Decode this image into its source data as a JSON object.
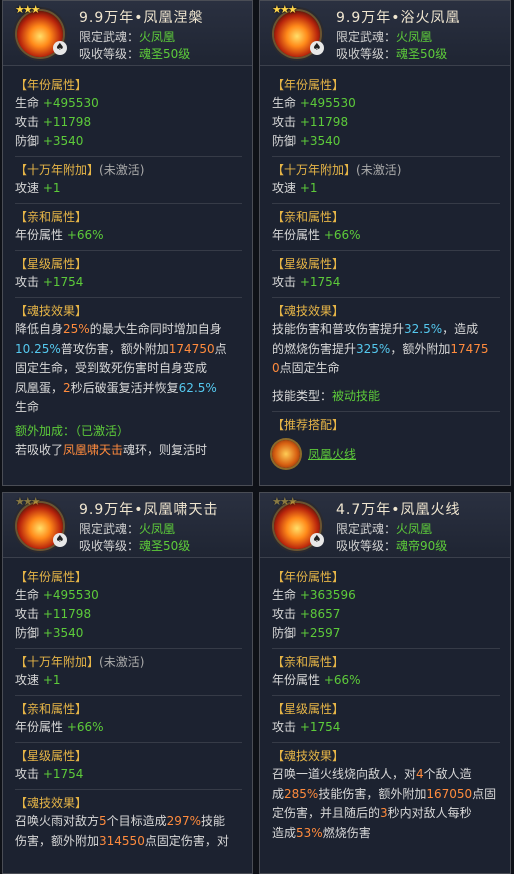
{
  "cards": [
    {
      "title": "9.9万年•凤凰涅槃",
      "limit_label": "限定武魂：",
      "limit_value": "火凤凰",
      "level_label": "吸收等级：",
      "level_value": "魂圣50级",
      "year": {
        "header": "【年份属性】",
        "hp_label": "生命",
        "hp": "+495530",
        "atk_label": "攻击",
        "atk": "+11798",
        "def_label": "防御",
        "def": "+3540"
      },
      "bonus": {
        "header": "【十万年附加】",
        "status": "(未激活)",
        "label": "攻速",
        "value": "+1"
      },
      "affinity": {
        "header": "【亲和属性】",
        "label": "年份属性",
        "value": "+66%"
      },
      "star": {
        "header": "【星级属性】",
        "label": "攻击",
        "value": "+1754"
      },
      "skill_header": "【魂技效果】",
      "skill": {
        "l1a": "降低自身",
        "l1b": "25%",
        "l1c": "的最大生命同时增加自身",
        "l2a": "10.25%",
        "l2b": "普攻伤害，额外附加",
        "l2c": "174750",
        "l2d": "点",
        "l3": "固定生命，受到致死伤害时自身变成",
        "l4a": "凤凰蛋，",
        "l4b": "2",
        "l4c": "秒后破蛋复活并恢复",
        "l4d": "62.5%",
        "l5": "生命"
      },
      "extra": {
        "label": "额外加成：（已激活）",
        "l1a": "若吸收了",
        "l1b": "凤凰啸天击",
        "l1c": "魂环，则复活时"
      }
    },
    {
      "title": "9.9万年•浴火凤凰",
      "limit_label": "限定武魂：",
      "limit_value": "火凤凰",
      "level_label": "吸收等级：",
      "level_value": "魂圣50级",
      "year": {
        "header": "【年份属性】",
        "hp_label": "生命",
        "hp": "+495530",
        "atk_label": "攻击",
        "atk": "+11798",
        "def_label": "防御",
        "def": "+3540"
      },
      "bonus": {
        "header": "【十万年附加】",
        "status": "(未激活)",
        "label": "攻速",
        "value": "+1"
      },
      "affinity": {
        "header": "【亲和属性】",
        "label": "年份属性",
        "value": "+66%"
      },
      "star": {
        "header": "【星级属性】",
        "label": "攻击",
        "value": "+1754"
      },
      "skill_header": "【魂技效果】",
      "skill": {
        "l1a": "技能伤害和普攻伤害提升",
        "l1b": "32.5%",
        "l1c": "，造成",
        "l2a": "的燃烧伤害提升",
        "l2b": "325%",
        "l2c": "，额外附加",
        "l2d": "17475",
        "l3a": "0",
        "l3b": "点固定生命",
        "type_label": "技能类型：",
        "type_value": "被动技能"
      },
      "rec": {
        "header": "【推荐搭配】",
        "name": "凤凰火线"
      }
    },
    {
      "title": "9.9万年•凤凰啸天击",
      "limit_label": "限定武魂：",
      "limit_value": "火凤凰",
      "level_label": "吸收等级：",
      "level_value": "魂圣50级",
      "year": {
        "header": "【年份属性】",
        "hp_label": "生命",
        "hp": "+495530",
        "atk_label": "攻击",
        "atk": "+11798",
        "def_label": "防御",
        "def": "+3540"
      },
      "bonus": {
        "header": "【十万年附加】",
        "status": "(未激活)",
        "label": "攻速",
        "value": "+1"
      },
      "affinity": {
        "header": "【亲和属性】",
        "label": "年份属性",
        "value": "+66%"
      },
      "star": {
        "header": "【星级属性】",
        "label": "攻击",
        "value": "+1754"
      },
      "skill_header": "【魂技效果】",
      "skill": {
        "l1a": "召唤火雨对敌方",
        "l1b": "5",
        "l1c": "个目标造成",
        "l1d": "297%",
        "l1e": "技能",
        "l2a": "伤害，额外附加",
        "l2b": "314550",
        "l2c": "点固定伤害，对"
      }
    },
    {
      "title": "4.7万年•凤凰火线",
      "limit_label": "限定武魂：",
      "limit_value": "火凤凰",
      "level_label": "吸收等级：",
      "level_value": "魂帝90级",
      "year": {
        "header": "【年份属性】",
        "hp_label": "生命",
        "hp": "+363596",
        "atk_label": "攻击",
        "atk": "+8657",
        "def_label": "防御",
        "def": "+2597"
      },
      "affinity": {
        "header": "【亲和属性】",
        "label": "年份属性",
        "value": "+66%"
      },
      "star": {
        "header": "【星级属性】",
        "label": "攻击",
        "value": "+1754"
      },
      "skill_header": "【魂技效果】",
      "skill": {
        "l1a": "召唤一道火线烧向敌人，对",
        "l1b": "4",
        "l1c": "个敌人造",
        "l2a": "成",
        "l2b": "285%",
        "l2c": "技能伤害，额外附加",
        "l2d": "167050",
        "l2e": "点固",
        "l3a": "定伤害，并且随后的",
        "l3b": "3",
        "l3c": "秒内对敌人每秒",
        "l4a": "造成",
        "l4b": "53%",
        "l4c": "燃烧伤害"
      }
    }
  ]
}
